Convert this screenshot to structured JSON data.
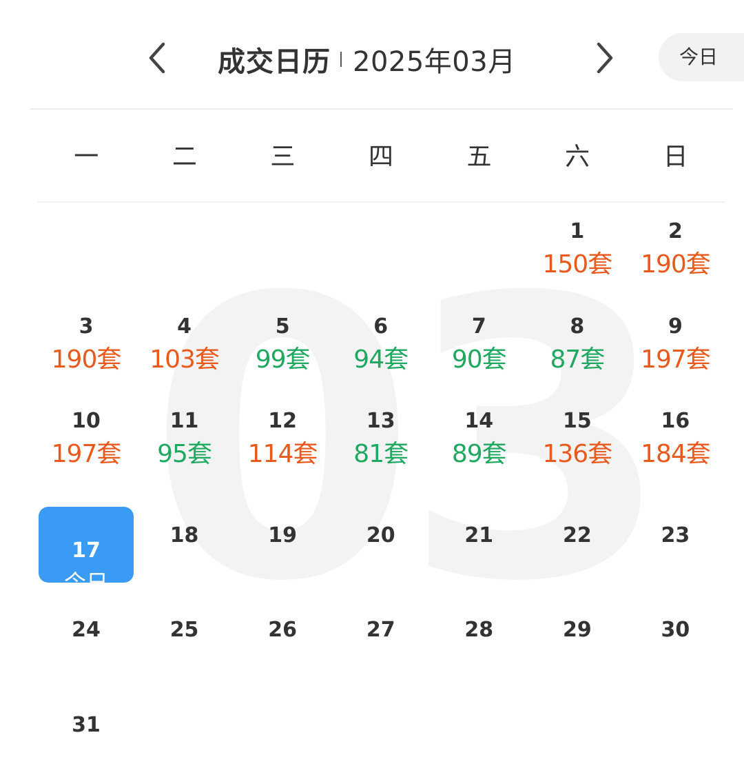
{
  "header": {
    "title": "成交日历",
    "month": "2025年03月",
    "today_button": "今日",
    "prev_icon": "chevron-left-icon",
    "next_icon": "chevron-right-icon"
  },
  "watermark": "03",
  "weekdays": [
    "一",
    "二",
    "三",
    "四",
    "五",
    "六",
    "日"
  ],
  "colors": {
    "high": "#e8591c",
    "low": "#1ea860",
    "today_bg": "#3a9bf5"
  },
  "today": {
    "day": "17",
    "label": "今日"
  },
  "days": [
    {
      "day": "1",
      "deal": "150套",
      "level": "high"
    },
    {
      "day": "2",
      "deal": "190套",
      "level": "high"
    },
    {
      "day": "3",
      "deal": "190套",
      "level": "high"
    },
    {
      "day": "4",
      "deal": "103套",
      "level": "high"
    },
    {
      "day": "5",
      "deal": "99套",
      "level": "low"
    },
    {
      "day": "6",
      "deal": "94套",
      "level": "low"
    },
    {
      "day": "7",
      "deal": "90套",
      "level": "low"
    },
    {
      "day": "8",
      "deal": "87套",
      "level": "low"
    },
    {
      "day": "9",
      "deal": "197套",
      "level": "high"
    },
    {
      "day": "10",
      "deal": "197套",
      "level": "high"
    },
    {
      "day": "11",
      "deal": "95套",
      "level": "low"
    },
    {
      "day": "12",
      "deal": "114套",
      "level": "high"
    },
    {
      "day": "13",
      "deal": "81套",
      "level": "low"
    },
    {
      "day": "14",
      "deal": "89套",
      "level": "low"
    },
    {
      "day": "15",
      "deal": "136套",
      "level": "high"
    },
    {
      "day": "16",
      "deal": "184套",
      "level": "high"
    },
    {
      "day": "17",
      "deal": "",
      "level": "today"
    },
    {
      "day": "18",
      "deal": "",
      "level": "none"
    },
    {
      "day": "19",
      "deal": "",
      "level": "none"
    },
    {
      "day": "20",
      "deal": "",
      "level": "none"
    },
    {
      "day": "21",
      "deal": "",
      "level": "none"
    },
    {
      "day": "22",
      "deal": "",
      "level": "none"
    },
    {
      "day": "23",
      "deal": "",
      "level": "none"
    },
    {
      "day": "24",
      "deal": "",
      "level": "none"
    },
    {
      "day": "25",
      "deal": "",
      "level": "none"
    },
    {
      "day": "26",
      "deal": "",
      "level": "none"
    },
    {
      "day": "27",
      "deal": "",
      "level": "none"
    },
    {
      "day": "28",
      "deal": "",
      "level": "none"
    },
    {
      "day": "29",
      "deal": "",
      "level": "none"
    },
    {
      "day": "30",
      "deal": "",
      "level": "none"
    },
    {
      "day": "31",
      "deal": "",
      "level": "none"
    }
  ]
}
